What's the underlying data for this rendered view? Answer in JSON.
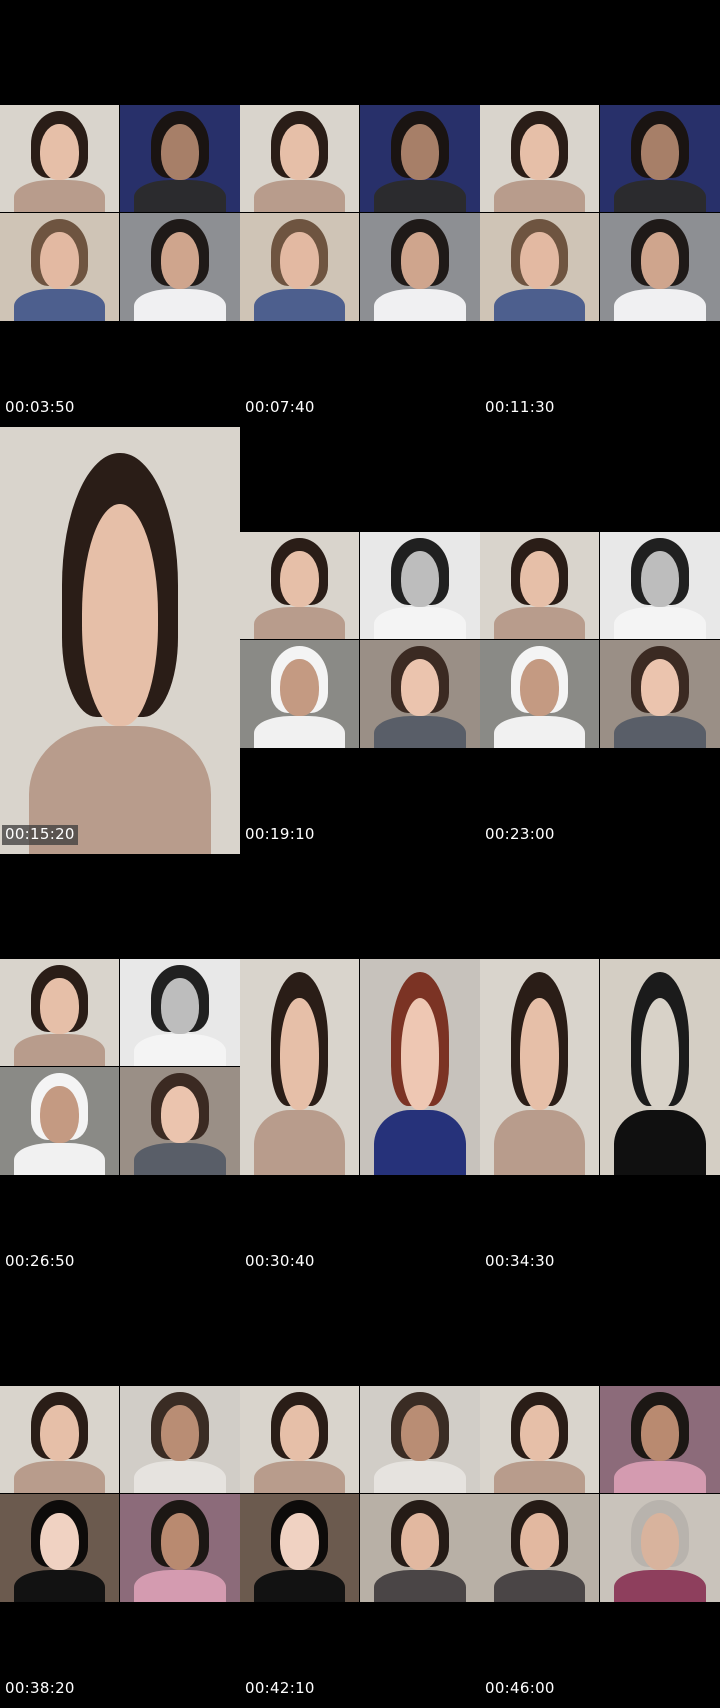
{
  "timestamps": [
    "00:03:50",
    "00:07:40",
    "00:11:30",
    "00:15:20",
    "00:19:10",
    "00:23:00",
    "00:26:50",
    "00:30:40",
    "00:34:30",
    "00:38:20",
    "00:42:10",
    "00:46:00"
  ],
  "colors": {
    "background": "#000000",
    "timestamp_text": "#ffffff",
    "timestamp_box": "#3c3c3c"
  }
}
